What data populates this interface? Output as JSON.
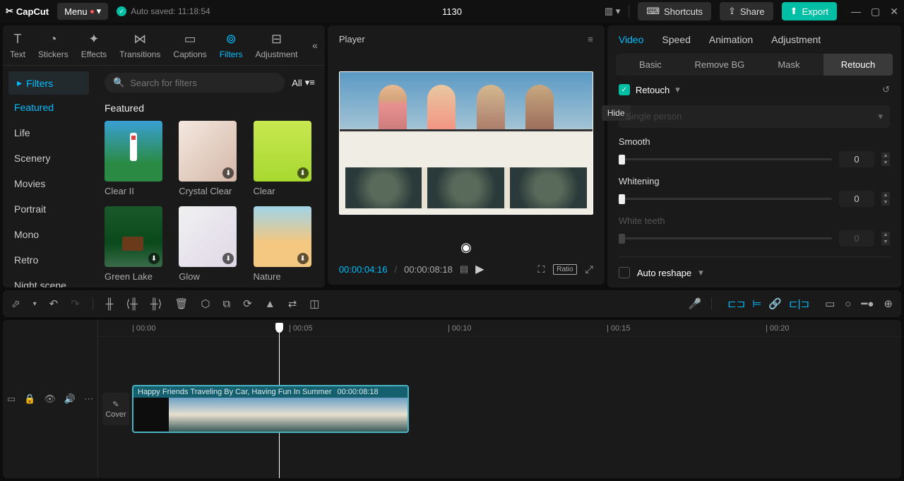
{
  "app": {
    "name": "CapCut",
    "menu": "Menu",
    "autosave": "Auto saved: 11:18:54",
    "project_title": "1130"
  },
  "topbar": {
    "shortcuts": "Shortcuts",
    "share": "Share",
    "export": "Export"
  },
  "tool_tabs": [
    "Text",
    "Stickers",
    "Effects",
    "Transitions",
    "Captions",
    "Filters",
    "Adjustment"
  ],
  "left_nav": {
    "top": "Filters",
    "items": [
      "Featured",
      "Life",
      "Scenery",
      "Movies",
      "Portrait",
      "Mono",
      "Retro",
      "Night scene"
    ]
  },
  "search": {
    "placeholder": "Search for filters",
    "all": "All"
  },
  "filters": {
    "section": "Featured",
    "items": [
      "Clear II",
      "Crystal Clear",
      "Clear",
      "Green Lake",
      "Glow",
      "Nature"
    ]
  },
  "player": {
    "title": "Player",
    "current": "00:00:04:16",
    "total": "00:00:08:18",
    "ratio": "Ratio"
  },
  "right": {
    "tabs": [
      "Video",
      "Speed",
      "Animation",
      "Adjustment"
    ],
    "sub_tabs": [
      "Basic",
      "Remove BG",
      "Mask",
      "Retouch"
    ],
    "retouch": "Retouch",
    "hide": "Hide",
    "dropdown": "Single person",
    "sliders": {
      "smooth": "Smooth",
      "whitening": "Whitening",
      "white_teeth": "White teeth"
    },
    "values": {
      "smooth": "0",
      "whitening": "0",
      "white_teeth": "0"
    },
    "auto_reshape": "Auto reshape"
  },
  "timeline": {
    "marks": [
      "00:00",
      "00:05",
      "00:10",
      "00:15",
      "00:20"
    ],
    "cover": "Cover",
    "clip_name": "Happy Friends Traveling By Car, Having Fun In Summer",
    "clip_dur": "00:00:08:18"
  }
}
